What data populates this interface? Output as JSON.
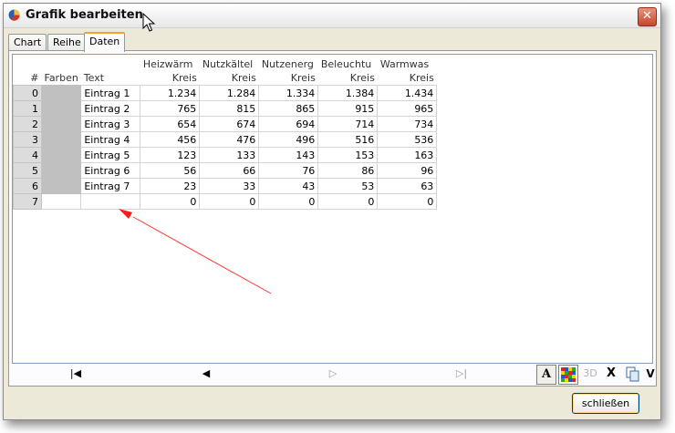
{
  "window": {
    "title": "Grafik bearbeiten",
    "close_symbol": "✕"
  },
  "tabs": [
    {
      "label": "Chart",
      "active": false
    },
    {
      "label": "Reihe",
      "active": false
    },
    {
      "label": "Daten",
      "active": true
    }
  ],
  "grid": {
    "index_header": "#",
    "color_header": "Farben",
    "text_header": "Text",
    "series_headers": [
      "Heizwärm",
      "Nutzkältel",
      "Nutzenerg",
      "Beleuchtu",
      "Warmwas"
    ],
    "series_types": [
      "Kreis",
      "Kreis",
      "Kreis",
      "Kreis",
      "Kreis"
    ],
    "rows": [
      {
        "index": "0",
        "text": "Eintrag 1",
        "values": [
          "1.234",
          "1.284",
          "1.334",
          "1.384",
          "1.434"
        ]
      },
      {
        "index": "1",
        "text": "Eintrag 2",
        "values": [
          "765",
          "815",
          "865",
          "915",
          "965"
        ]
      },
      {
        "index": "2",
        "text": "Eintrag 3",
        "values": [
          "654",
          "674",
          "694",
          "714",
          "734"
        ]
      },
      {
        "index": "3",
        "text": "Eintrag 4",
        "values": [
          "456",
          "476",
          "496",
          "516",
          "536"
        ]
      },
      {
        "index": "4",
        "text": "Eintrag 5",
        "values": [
          "123",
          "133",
          "143",
          "153",
          "163"
        ]
      },
      {
        "index": "5",
        "text": "Eintrag 6",
        "values": [
          "56",
          "66",
          "76",
          "86",
          "96"
        ]
      },
      {
        "index": "6",
        "text": "Eintrag 7",
        "values": [
          "23",
          "33",
          "43",
          "53",
          "63"
        ]
      }
    ],
    "new_row": {
      "index": "7",
      "text": "",
      "values": [
        "0",
        "0",
        "0",
        "0",
        "0"
      ]
    }
  },
  "navigator": {
    "first": "|◀",
    "prev": "◀",
    "next": "▷",
    "last": "▷|"
  },
  "toolbar": {
    "font_label": "A",
    "three_d_label": "3D",
    "delete_label": "X",
    "paste_label": "V"
  },
  "footer": {
    "close_label": "schließen"
  },
  "colors": {
    "accent": "#f0a42c",
    "annotation_arrow": "#ff3333",
    "color_cell": "#c0c0c0"
  }
}
